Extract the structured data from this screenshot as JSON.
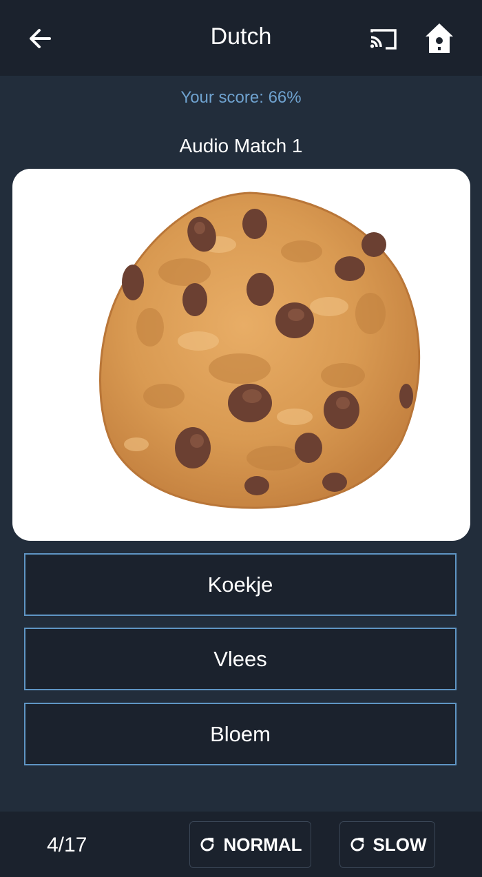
{
  "appbar": {
    "title": "Dutch",
    "back_icon": "arrow-left-icon",
    "cast_icon": "cast-icon",
    "home_icon": "birdhouse-icon"
  },
  "score_text": "Your score: 66%",
  "exercise_title": "Audio Match 1",
  "image": {
    "subject": "chocolate-chip-cookie"
  },
  "choices": [
    {
      "label": "Koekje"
    },
    {
      "label": "Vlees"
    },
    {
      "label": "Bloem"
    }
  ],
  "footer": {
    "progress": "4/17",
    "normal_label": "NORMAL",
    "slow_label": "SLOW",
    "replay_icon": "replay-icon"
  },
  "colors": {
    "background": "#222d3b",
    "bar": "#1b222d",
    "accent_text": "#6fa2cf",
    "choice_border": "#5f95c4"
  }
}
